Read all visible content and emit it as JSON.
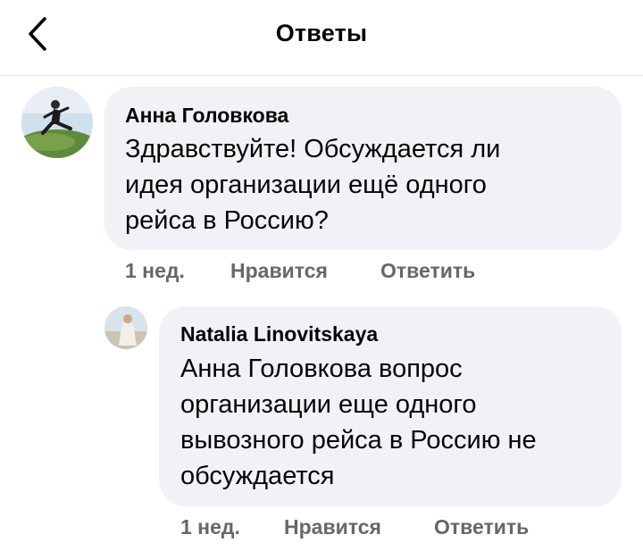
{
  "header": {
    "title": "Ответы",
    "back_icon": "chevron-left-icon"
  },
  "comments": [
    {
      "author": "Анна Головкова",
      "lines": [
        "Здравствуйте! Обсуждается ли",
        "идея организации ещё одного",
        "рейса в Россию?"
      ],
      "time": "1 нед.",
      "like_label": "Нравится",
      "reply_label": "Ответить"
    },
    {
      "author": "Natalia Linovitskaya",
      "lines": [
        "Анна Головкова  вопрос",
        "организации еще одного",
        "вывозного рейса в Россию не",
        "обсуждается"
      ],
      "time": "1 нед.",
      "like_label": "Нравится",
      "reply_label": "Ответить"
    }
  ],
  "colors": {
    "bubble": "#f0f2f5",
    "secondary_text": "#65676b",
    "divider": "#e4e6eb"
  }
}
